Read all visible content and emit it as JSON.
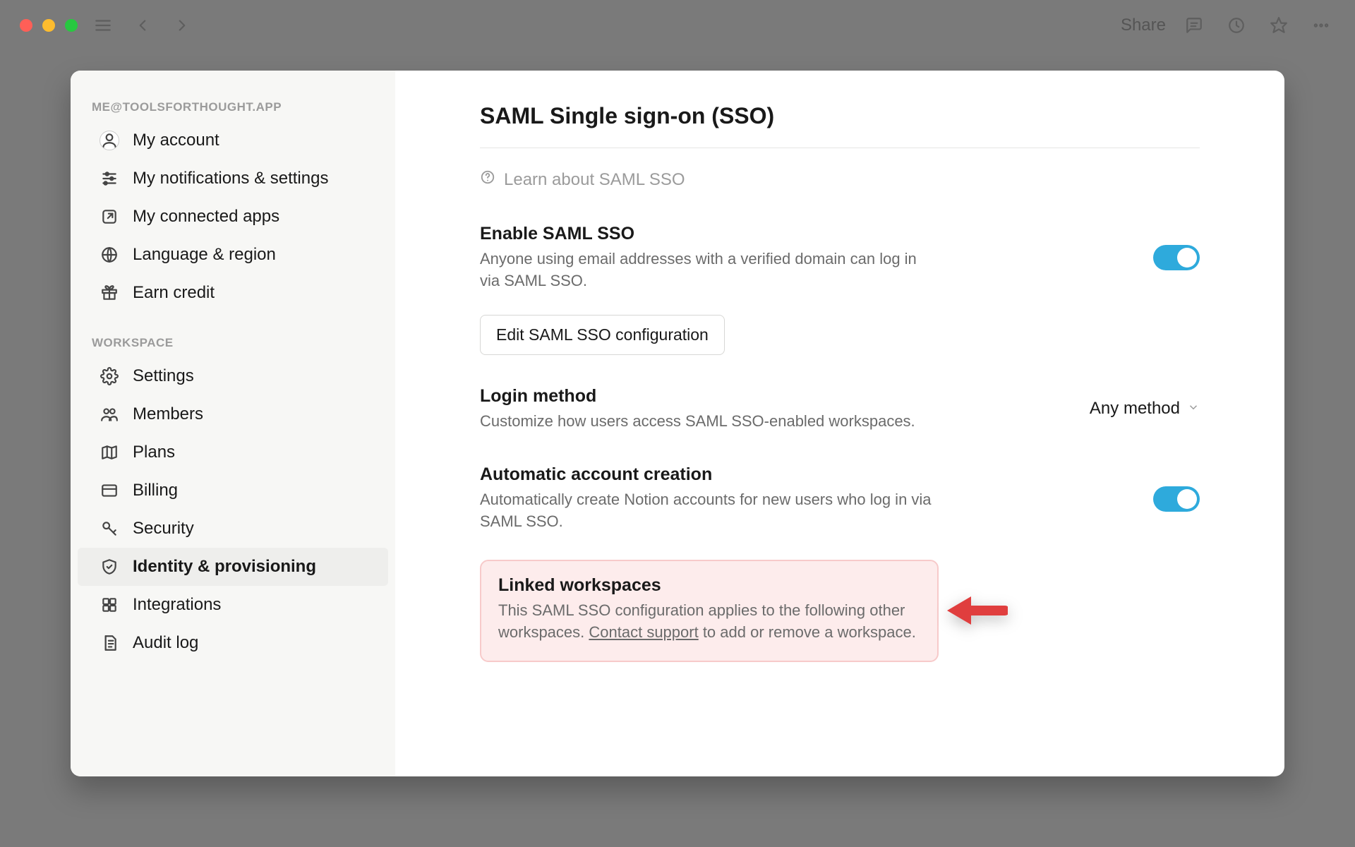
{
  "topbar": {
    "share_label": "Share"
  },
  "sidebar": {
    "account_header": "ME@TOOLSFORTHOUGHT.APP",
    "workspace_header": "WORKSPACE",
    "account_items": [
      {
        "label": "My account",
        "icon": "avatar"
      },
      {
        "label": "My notifications & settings",
        "icon": "sliders"
      },
      {
        "label": "My connected apps",
        "icon": "external"
      },
      {
        "label": "Language & region",
        "icon": "globe"
      },
      {
        "label": "Earn credit",
        "icon": "gift"
      }
    ],
    "workspace_items": [
      {
        "label": "Settings",
        "icon": "gear"
      },
      {
        "label": "Members",
        "icon": "members"
      },
      {
        "label": "Plans",
        "icon": "plans"
      },
      {
        "label": "Billing",
        "icon": "billing"
      },
      {
        "label": "Security",
        "icon": "key"
      },
      {
        "label": "Identity & provisioning",
        "icon": "shield",
        "active": true
      },
      {
        "label": "Integrations",
        "icon": "integrations"
      },
      {
        "label": "Audit log",
        "icon": "auditlog"
      }
    ]
  },
  "page": {
    "title": "SAML Single sign-on (SSO)",
    "learn": "Learn about SAML SSO",
    "sections": {
      "enable": {
        "title": "Enable SAML SSO",
        "desc": "Anyone using email addresses with a verified domain can log in via SAML SSO.",
        "toggle": true,
        "button": "Edit SAML SSO configuration"
      },
      "login": {
        "title": "Login method",
        "desc": "Customize how users access SAML SSO-enabled workspaces.",
        "value": "Any method"
      },
      "auto": {
        "title": "Automatic account creation",
        "desc": "Automatically create Notion accounts for new users who log in via SAML SSO.",
        "toggle": true
      },
      "linked": {
        "title": "Linked workspaces",
        "desc_before": "This SAML SSO configuration applies to the following other workspaces. ",
        "link": "Contact support",
        "desc_after": " to add or remove a workspace."
      }
    }
  }
}
